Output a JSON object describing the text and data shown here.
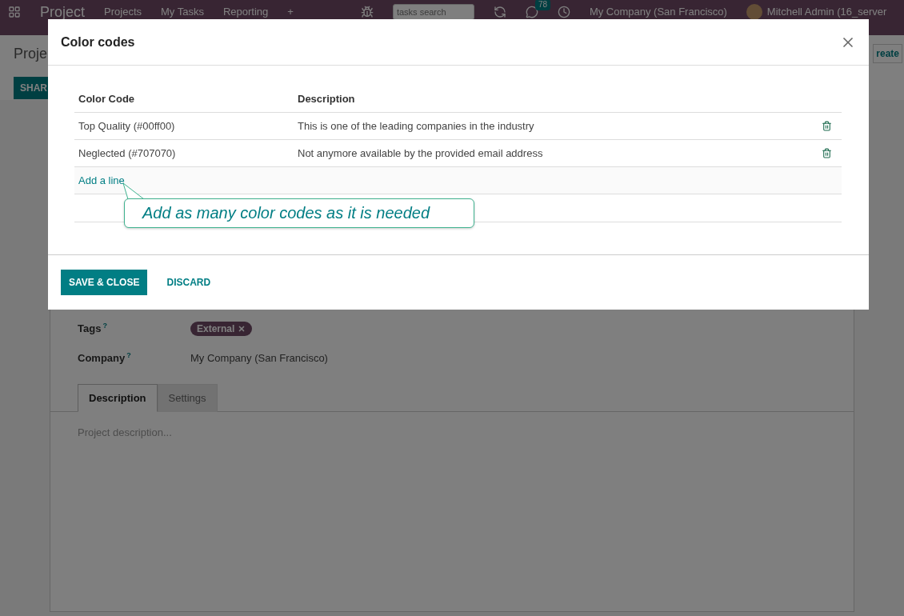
{
  "navbar": {
    "app": "Project",
    "menu": [
      "Projects",
      "My Tasks",
      "Reporting"
    ],
    "new_item": "+",
    "search": {
      "placeholder": "tasks search"
    },
    "messages_count": "78",
    "company": "My Company (San Francisco)",
    "user": "Mitchell Admin (16_server"
  },
  "breadcrumb": "Proje",
  "share_button": "SHAR",
  "create_button": "reate",
  "form": {
    "fields": [
      {
        "label": "Tags",
        "help": "?",
        "kind": "tags",
        "tags": [
          "External"
        ]
      },
      {
        "label": "Company",
        "help": "?",
        "kind": "text",
        "value": "My Company (San Francisco)"
      }
    ],
    "tabs": [
      {
        "label": "Description",
        "selected": true
      },
      {
        "label": "Settings",
        "selected": false
      }
    ],
    "description": {
      "placeholder": "Project description..."
    }
  },
  "dialog": {
    "title": "Color codes",
    "columns": [
      "Color Code",
      "Description"
    ],
    "rows": [
      {
        "color_code": "Top Quality (#00ff00)",
        "description": "This is one of the leading companies in the industry"
      },
      {
        "color_code": "Neglected (#707070)",
        "description": "Not anymore available by the provided email address"
      }
    ],
    "add_line": "Add a line",
    "callout": "Add as many color codes as it is needed",
    "buttons": [
      {
        "label": "SAVE & CLOSE",
        "kind": "primary"
      },
      {
        "label": "DISCARD",
        "kind": "link"
      }
    ]
  }
}
